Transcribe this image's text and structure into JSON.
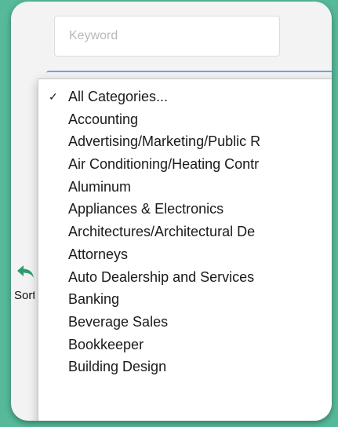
{
  "search": {
    "keyword_placeholder": "Keyword",
    "keyword_value": ""
  },
  "sort": {
    "label": "Sort",
    "icon": "reply-arrow-icon"
  },
  "category_dropdown": {
    "selected": "All Categories...",
    "check_glyph": "✓",
    "options": [
      "All Categories...",
      "Accounting",
      "Advertising/Marketing/Public R",
      "Air Conditioning/Heating Contr",
      "Aluminum",
      "Appliances & Electronics",
      "Architectures/Architectural De",
      "Attorneys",
      "Auto Dealership and Services",
      "Banking",
      "Beverage Sales",
      "Bookkeeper",
      "Building Design"
    ]
  },
  "colors": {
    "background": "#56b99a",
    "accent_arrow": "#2e9b6f",
    "focus_border": "#6aa6e0"
  }
}
